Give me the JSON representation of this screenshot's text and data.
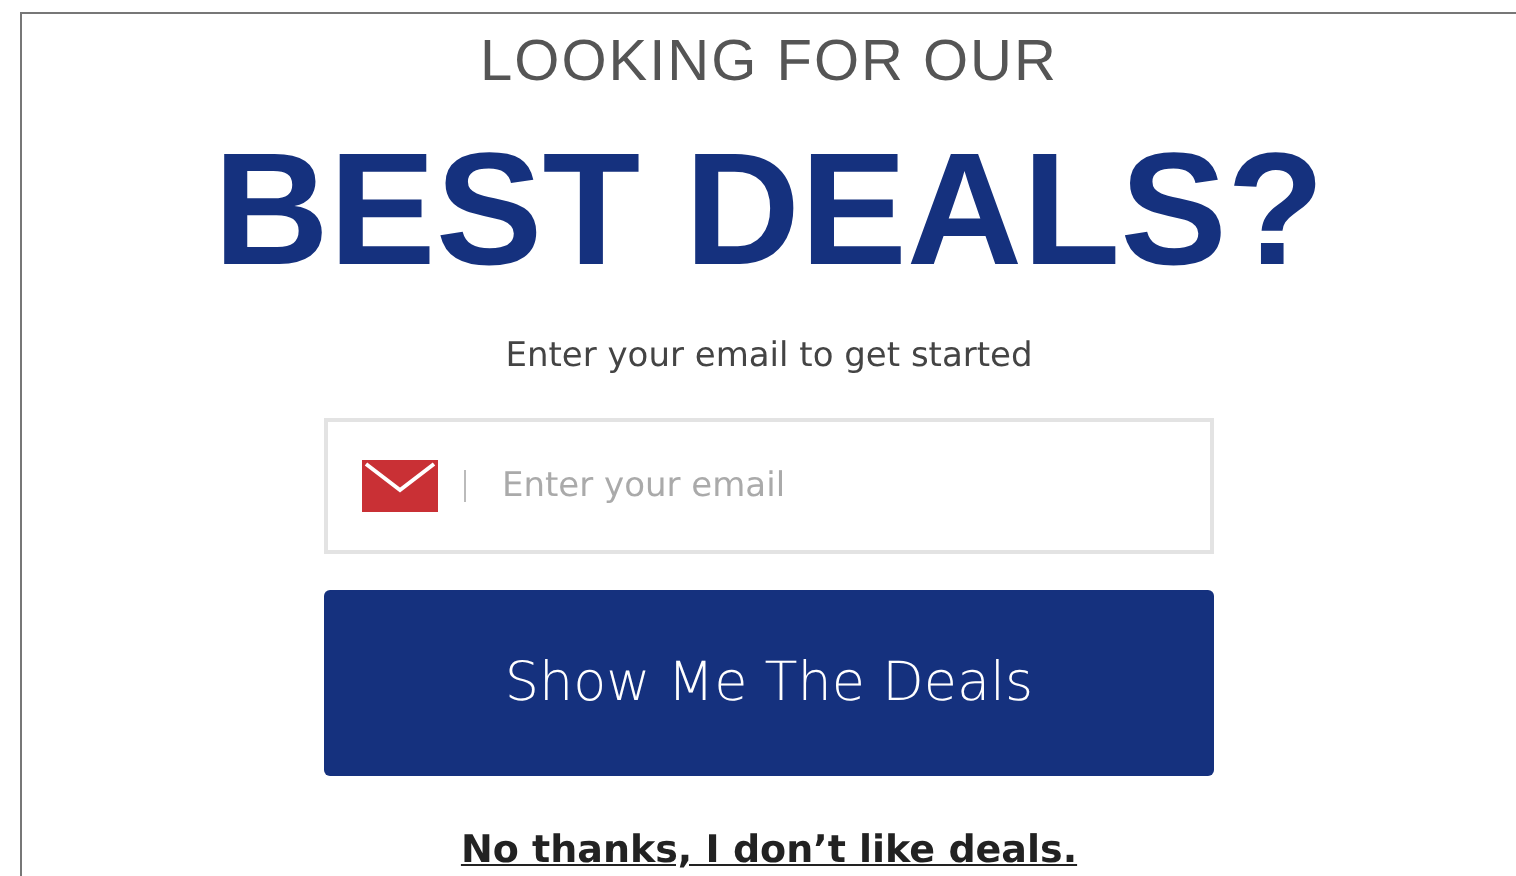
{
  "kicker": "LOOKING FOR OUR",
  "headline": "BEST DEALS?",
  "subtitle": "Enter your email to get started",
  "email_field": {
    "placeholder": "Enter your email"
  },
  "submit_button": "Show Me The Deals",
  "decline_link": "No thanks, I don’t like deals."
}
